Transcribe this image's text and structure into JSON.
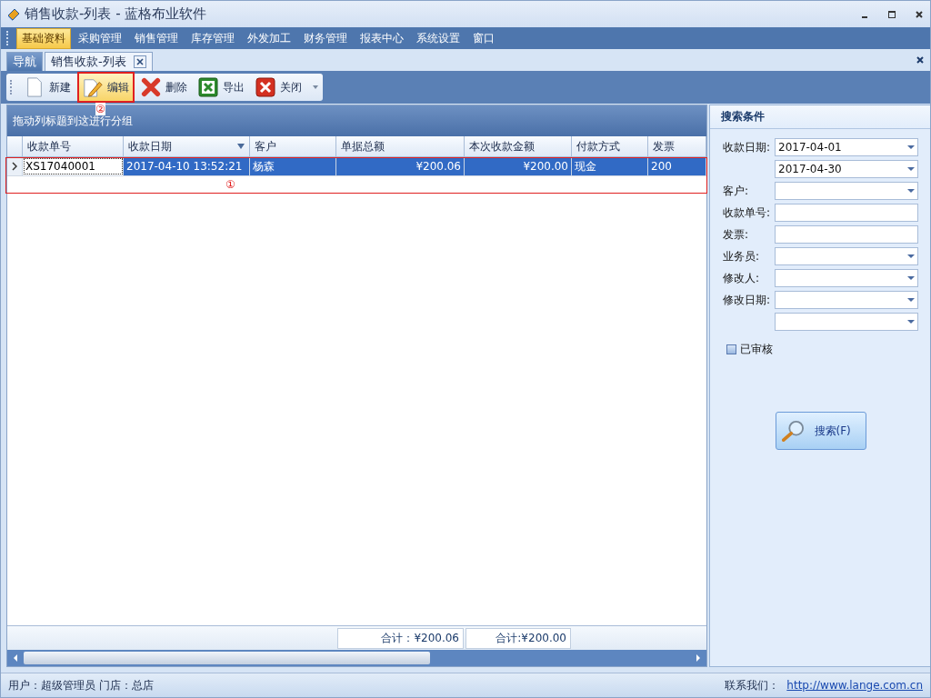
{
  "window": {
    "title": "销售收款-列表 - 蓝格布业软件"
  },
  "menu": [
    {
      "label": "基础资料",
      "selected": true
    },
    {
      "label": "采购管理",
      "selected": false
    },
    {
      "label": "销售管理",
      "selected": false
    },
    {
      "label": "库存管理",
      "selected": false
    },
    {
      "label": "外发加工",
      "selected": false
    },
    {
      "label": "财务管理",
      "selected": false
    },
    {
      "label": "报表中心",
      "selected": false
    },
    {
      "label": "系统设置",
      "selected": false
    },
    {
      "label": "窗口",
      "selected": false
    }
  ],
  "tabs": [
    {
      "label": "导航",
      "selected": false
    },
    {
      "label": "销售收款-列表",
      "selected": true
    }
  ],
  "toolbar": [
    {
      "kind": "new",
      "label": "新建",
      "selected": false
    },
    {
      "kind": "edit",
      "label": "编辑",
      "selected": true
    },
    {
      "kind": "delete",
      "label": "删除",
      "selected": false
    },
    {
      "kind": "export",
      "label": "导出",
      "selected": false
    },
    {
      "kind": "close",
      "label": "关闭",
      "selected": false
    }
  ],
  "grid": {
    "group_hint": "拖动列标题到这进行分组",
    "columns": [
      {
        "label": "收款单号",
        "sorted": false
      },
      {
        "label": "收款日期",
        "sorted": true
      },
      {
        "label": "客户",
        "sorted": false
      },
      {
        "label": "单据总额",
        "sorted": false,
        "total": "合计：¥200.06"
      },
      {
        "label": "本次收款金额",
        "sorted": false,
        "total": "合计:¥200.00"
      },
      {
        "label": "付款方式",
        "sorted": false
      },
      {
        "label": "发票",
        "sorted": false
      }
    ],
    "rows": [
      {
        "selected": true,
        "cells": [
          "XS17040001",
          "2017-04-10 13:52:21",
          "杨森",
          "¥200.06",
          "¥200.00",
          "现金",
          "200"
        ]
      }
    ]
  },
  "search": {
    "title": "搜索条件",
    "fields": [
      {
        "label": "收款日期:",
        "kind": "dropdown",
        "value": "2017-04-01"
      },
      {
        "kind": "dropdown",
        "value": "2017-04-30"
      },
      {
        "label": "客户:",
        "kind": "dropdown"
      },
      {
        "label": "收款单号:",
        "kind": "text"
      },
      {
        "label": "发票:",
        "kind": "text"
      },
      {
        "label": "业务员:",
        "kind": "dropdown"
      },
      {
        "label": "修改人:",
        "kind": "dropdown"
      },
      {
        "label": "修改日期:",
        "kind": "dropdown"
      },
      {
        "kind": "dropdown"
      }
    ],
    "checkbox": {
      "label": "已审核",
      "checked": false
    },
    "button": "搜索(F)"
  },
  "status_bar": {
    "user": "用户：超级管理员  门店：总店",
    "contact_label": "联系我们：",
    "link": "http://www.lange.com.cn"
  },
  "annotations": [
    "①",
    "②"
  ]
}
